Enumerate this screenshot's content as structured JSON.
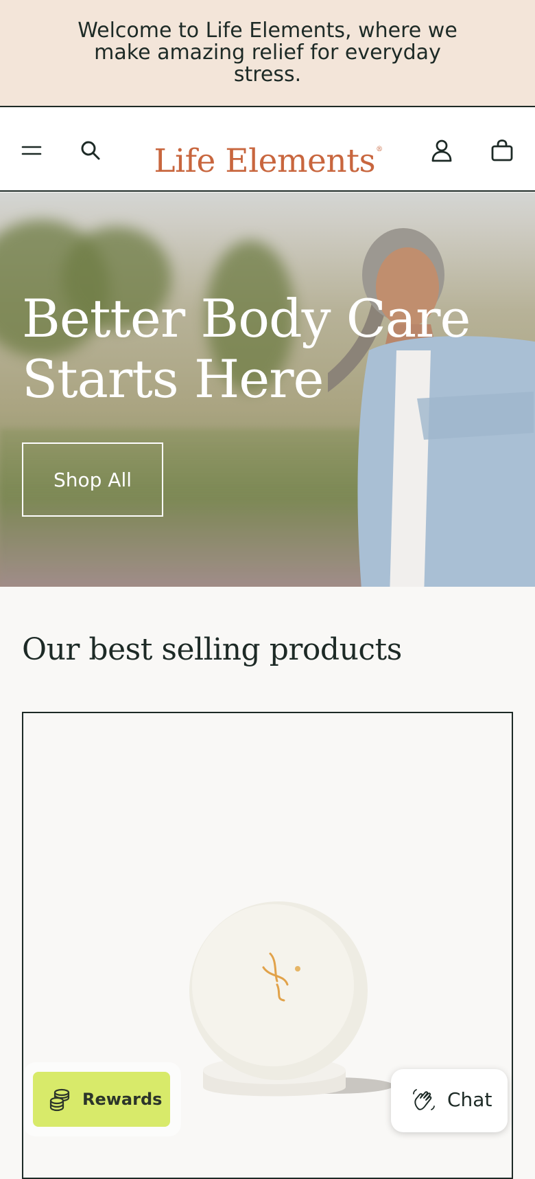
{
  "announcement": {
    "text": "Welcome to Life Elements, where we make amazing relief for everyday stress."
  },
  "header": {
    "logo_text": "Life Elements",
    "logo_mark": "®",
    "icons": {
      "menu": "menu-icon",
      "search": "search-icon",
      "account": "account-icon",
      "cart": "cart-icon"
    }
  },
  "hero": {
    "title": "Better Body Care Starts Here",
    "button_label": "Shop All"
  },
  "best_sellers": {
    "title": "Our best selling products"
  },
  "widgets": {
    "rewards_label": "Rewards",
    "chat_label": "Chat"
  },
  "colors": {
    "brand": "#c8663e",
    "announcement_bg": "#f3e5d9",
    "text_dark": "#1d2a26",
    "rewards_bg": "#d8ea6a",
    "page_bg": "#f9f8f6"
  }
}
